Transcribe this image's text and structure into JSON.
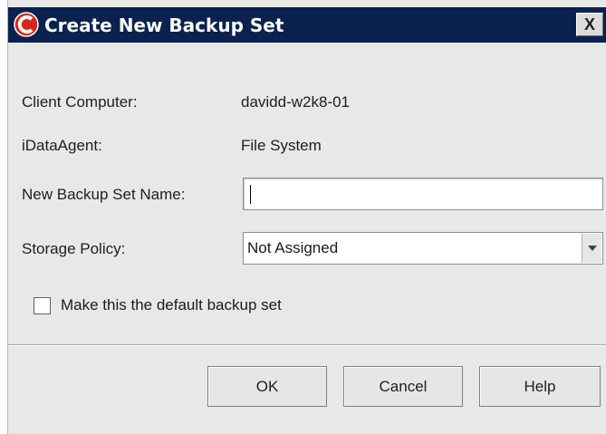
{
  "dialog": {
    "title": "Create New Backup Set",
    "close_label": "X"
  },
  "form": {
    "client_computer_label": "Client Computer:",
    "client_computer_value": "davidd-w2k8-01",
    "idataagent_label": "iDataAgent:",
    "idataagent_value": "File System",
    "backup_set_name_label": "New Backup Set Name:",
    "backup_set_name_value": "",
    "storage_policy_label": "Storage Policy:",
    "storage_policy_value": "Not Assigned",
    "default_checkbox_label": "Make this the default backup set",
    "default_checkbox_checked": false
  },
  "buttons": {
    "ok": "OK",
    "cancel": "Cancel",
    "help": "Help"
  },
  "colors": {
    "titlebar": "#0b2150",
    "dialog_background": "#e8e8e8",
    "logo_red": "#d8261c"
  },
  "icons": {
    "title": "commvault-logo-icon",
    "close": "close-icon",
    "dropdown": "chevron-down-icon"
  }
}
